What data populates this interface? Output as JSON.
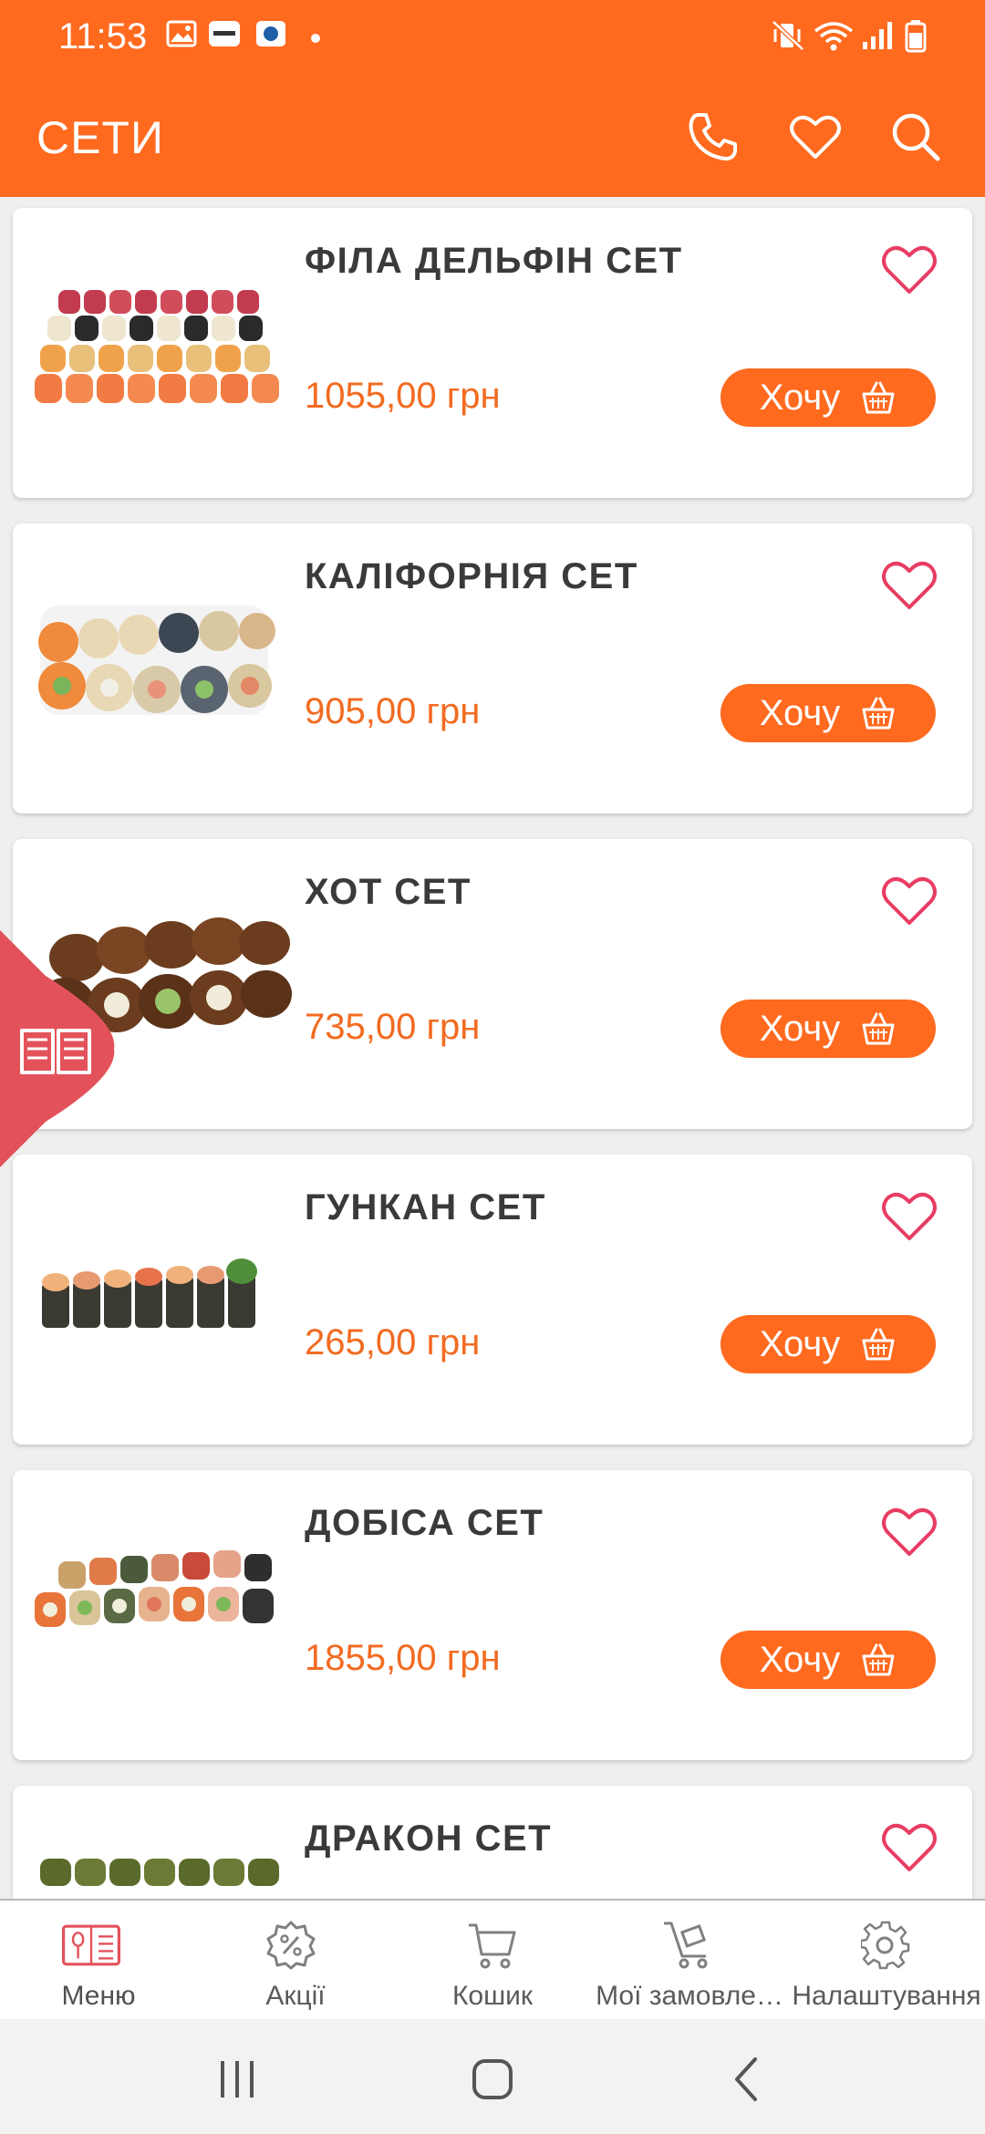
{
  "status_bar": {
    "time": "11:53",
    "icons": [
      "gallery-icon",
      "app-notification-icon",
      "app-notification-icon",
      "dot-icon",
      "vibrate-mute-icon",
      "wifi-icon",
      "signal-icon",
      "battery-icon"
    ]
  },
  "app_bar": {
    "title": "СЕТИ",
    "actions": [
      "phone-icon",
      "heart-icon",
      "search-icon"
    ]
  },
  "colors": {
    "primary": "#ff6a1f",
    "price": "#f26b21",
    "favorite": "#e83d63",
    "side_tab": "#e3525a"
  },
  "products": [
    {
      "name": "ФІЛА ДЕЛЬФІН СЕТ",
      "price": "1055,00 грн",
      "button": "Хочу"
    },
    {
      "name": "КАЛІФОРНІЯ СЕТ",
      "price": "905,00 грн",
      "button": "Хочу"
    },
    {
      "name": "ХОТ СЕТ",
      "price": "735,00 грн",
      "button": "Хочу"
    },
    {
      "name": "ГУНКАН СЕТ",
      "price": "265,00 грн",
      "button": "Хочу"
    },
    {
      "name": "ДОБІСА СЕТ",
      "price": "1855,00 грн",
      "button": "Хочу"
    },
    {
      "name": "ДРАКОН СЕТ",
      "price": "",
      "button": ""
    }
  ],
  "bottom_nav": [
    {
      "label": "Меню",
      "icon": "menu-book-icon",
      "active": true
    },
    {
      "label": "Акції",
      "icon": "discount-icon",
      "active": false
    },
    {
      "label": "Кошик",
      "icon": "cart-icon",
      "active": false
    },
    {
      "label": "Мої замовле…",
      "icon": "delivery-cart-icon",
      "active": false
    },
    {
      "label": "Налаштування",
      "icon": "gear-icon",
      "active": false
    }
  ]
}
